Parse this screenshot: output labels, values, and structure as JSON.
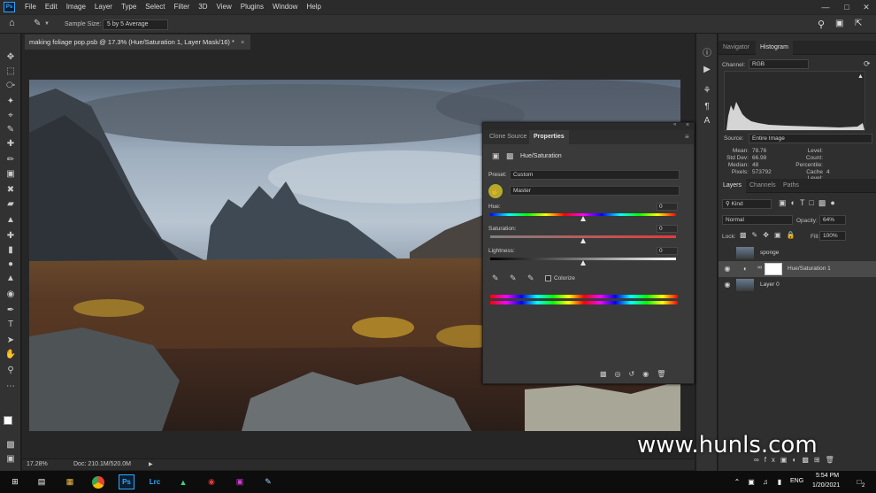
{
  "menubar": {
    "app_icon": "Ps",
    "items": [
      "File",
      "Edit",
      "Image",
      "Layer",
      "Type",
      "Select",
      "Filter",
      "3D",
      "View",
      "Plugins",
      "Window",
      "Help"
    ],
    "window_controls": [
      "minimize-icon",
      "maximize-icon",
      "close-icon"
    ]
  },
  "options_bar": {
    "sample_size_label": "Sample Size:",
    "sample_size_value": "5 by 5 Average"
  },
  "document": {
    "tab_title": "making foliage pop.psb @ 17.3% (Hue/Saturation 1, Layer Mask/16) *",
    "zoom": "17.28%",
    "doc_size": "Doc: 210.1M/520.0M"
  },
  "navigator": {
    "tabs": [
      "Navigator",
      "Histogram"
    ],
    "active_tab": "Histogram",
    "channel_label": "Channel:",
    "channel_value": "RGB",
    "source_label": "Source:",
    "source_value": "Entire Image",
    "stats_left": [
      {
        "label": "Mean:",
        "value": "78.76"
      },
      {
        "label": "Std Dev:",
        "value": "66.98"
      },
      {
        "label": "Median:",
        "value": "48"
      },
      {
        "label": "Pixels:",
        "value": "573792"
      }
    ],
    "stats_right": [
      {
        "label": "Level:",
        "value": ""
      },
      {
        "label": "Count:",
        "value": ""
      },
      {
        "label": "Percentile:",
        "value": ""
      },
      {
        "label": "Cache Level:",
        "value": "4"
      }
    ]
  },
  "layers": {
    "tabs": [
      "Layers",
      "Channels",
      "Paths"
    ],
    "active_tab": "Layers",
    "filter_value": "Kind",
    "blend_mode": "Normal",
    "opacity_label": "Opacity:",
    "opacity_value": "64%",
    "lock_label": "Lock:",
    "fill_label": "Fill:",
    "fill_value": "100%",
    "items": [
      {
        "name": "sponge",
        "visible": false,
        "selected": false
      },
      {
        "name": "Hue/Saturation 1",
        "visible": true,
        "selected": true
      },
      {
        "name": "Layer 0",
        "visible": true,
        "selected": false
      }
    ]
  },
  "properties": {
    "tabs": [
      "Clone Source",
      "Properties"
    ],
    "active_tab": "Properties",
    "adjustment_title": "Hue/Saturation",
    "preset_label": "Preset:",
    "preset_value": "Custom",
    "range_value": "Master",
    "hue_label": "Hue:",
    "hue_value": "0",
    "saturation_label": "Saturation:",
    "saturation_value": "0",
    "lightness_label": "Lightness:",
    "lightness_value": "0",
    "colorize_label": "Colorize",
    "colorize_checked": false,
    "hue_position": 0.5,
    "saturation_position": 0.5,
    "lightness_position": 0.5
  },
  "watermark": "www.hunls.com",
  "taskbar": {
    "time": "5:54 PM",
    "date": "1/20/2021",
    "language": "ENG",
    "notification_count": "2"
  },
  "colors": {
    "menubar_bg": "#2b2b2b",
    "panel_bg": "#2f2f2f",
    "accent": "#31a8ff"
  }
}
